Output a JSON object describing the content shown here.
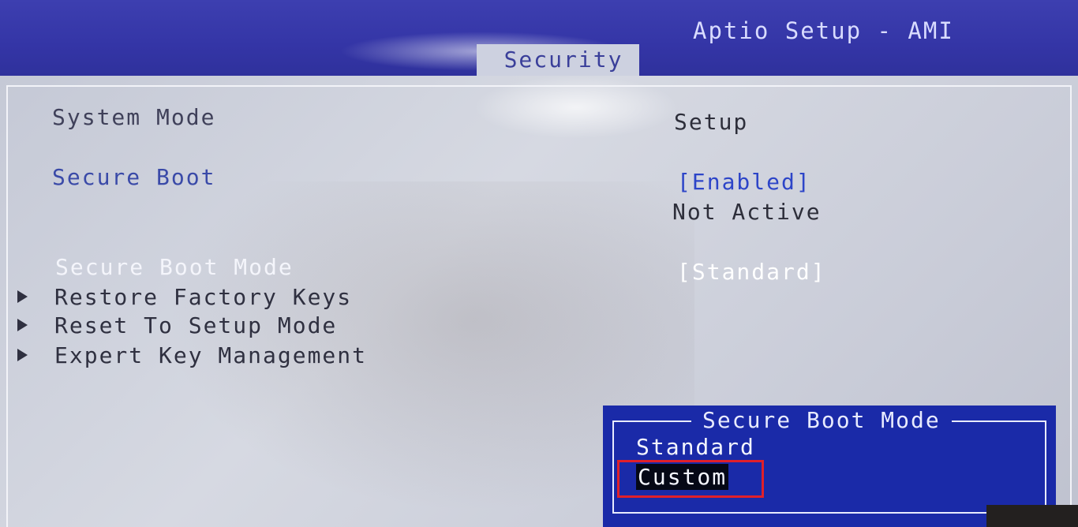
{
  "header": {
    "app_title": "Aptio Setup - AMI",
    "active_tab": "Security"
  },
  "settings": {
    "system_mode": {
      "label": "System Mode",
      "value": "Setup"
    },
    "secure_boot": {
      "label": "Secure Boot",
      "value": "[Enabled]",
      "status": "Not Active"
    },
    "secure_boot_mode": {
      "label": "Secure Boot Mode",
      "value": "[Standard]"
    }
  },
  "submenus": [
    {
      "label": "Restore Factory Keys"
    },
    {
      "label": "Reset To Setup Mode"
    },
    {
      "label": "Expert Key Management"
    }
  ],
  "popup": {
    "title": "Secure Boot Mode",
    "options": [
      "Standard",
      "Custom"
    ],
    "selected": "Custom"
  },
  "colors": {
    "header_blue": "#3435a6",
    "popup_blue": "#1a2aa8",
    "highlight_red": "#e0202a"
  }
}
